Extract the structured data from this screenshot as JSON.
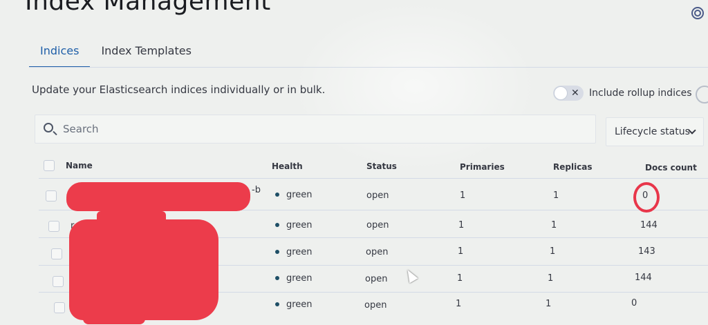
{
  "page": {
    "title": "Index Management"
  },
  "tabs": [
    {
      "label": "Indices",
      "active": true
    },
    {
      "label": "Index Templates",
      "active": false
    }
  ],
  "description": "Update your Elasticsearch indices individually or in bulk.",
  "rollup_toggle": {
    "label": "Include rollup indices",
    "checked": false,
    "off_glyph": "✕"
  },
  "search": {
    "placeholder": "Search",
    "value": ""
  },
  "lifecycle_filter": {
    "label": "Lifecycle status"
  },
  "table": {
    "columns": [
      "Name",
      "Health",
      "Status",
      "Primaries",
      "Replicas",
      "Docs count"
    ],
    "rows": [
      {
        "name_suffix": "-b",
        "health": "green",
        "status": "open",
        "primaries": "1",
        "replicas": "1",
        "docs_count": "0"
      },
      {
        "name_suffix": "r",
        "health": "green",
        "status": "open",
        "primaries": "1",
        "replicas": "1",
        "docs_count": "144"
      },
      {
        "name_suffix": "",
        "health": "green",
        "status": "open",
        "primaries": "1",
        "replicas": "1",
        "docs_count": "143"
      },
      {
        "name_suffix": "",
        "health": "green",
        "status": "open",
        "primaries": "1",
        "replicas": "1",
        "docs_count": "144"
      },
      {
        "name_suffix": "",
        "health": "green",
        "status": "open",
        "primaries": "1",
        "replicas": "1",
        "docs_count": "0"
      }
    ]
  },
  "colors": {
    "accent": "#1f5fa8",
    "health_dot": "#1e4f66",
    "redaction": "#ec3c4b",
    "highlight_circle": "#e8364a"
  },
  "icons": [
    "help-icon",
    "search-icon",
    "chevron-down-icon",
    "close-icon"
  ]
}
